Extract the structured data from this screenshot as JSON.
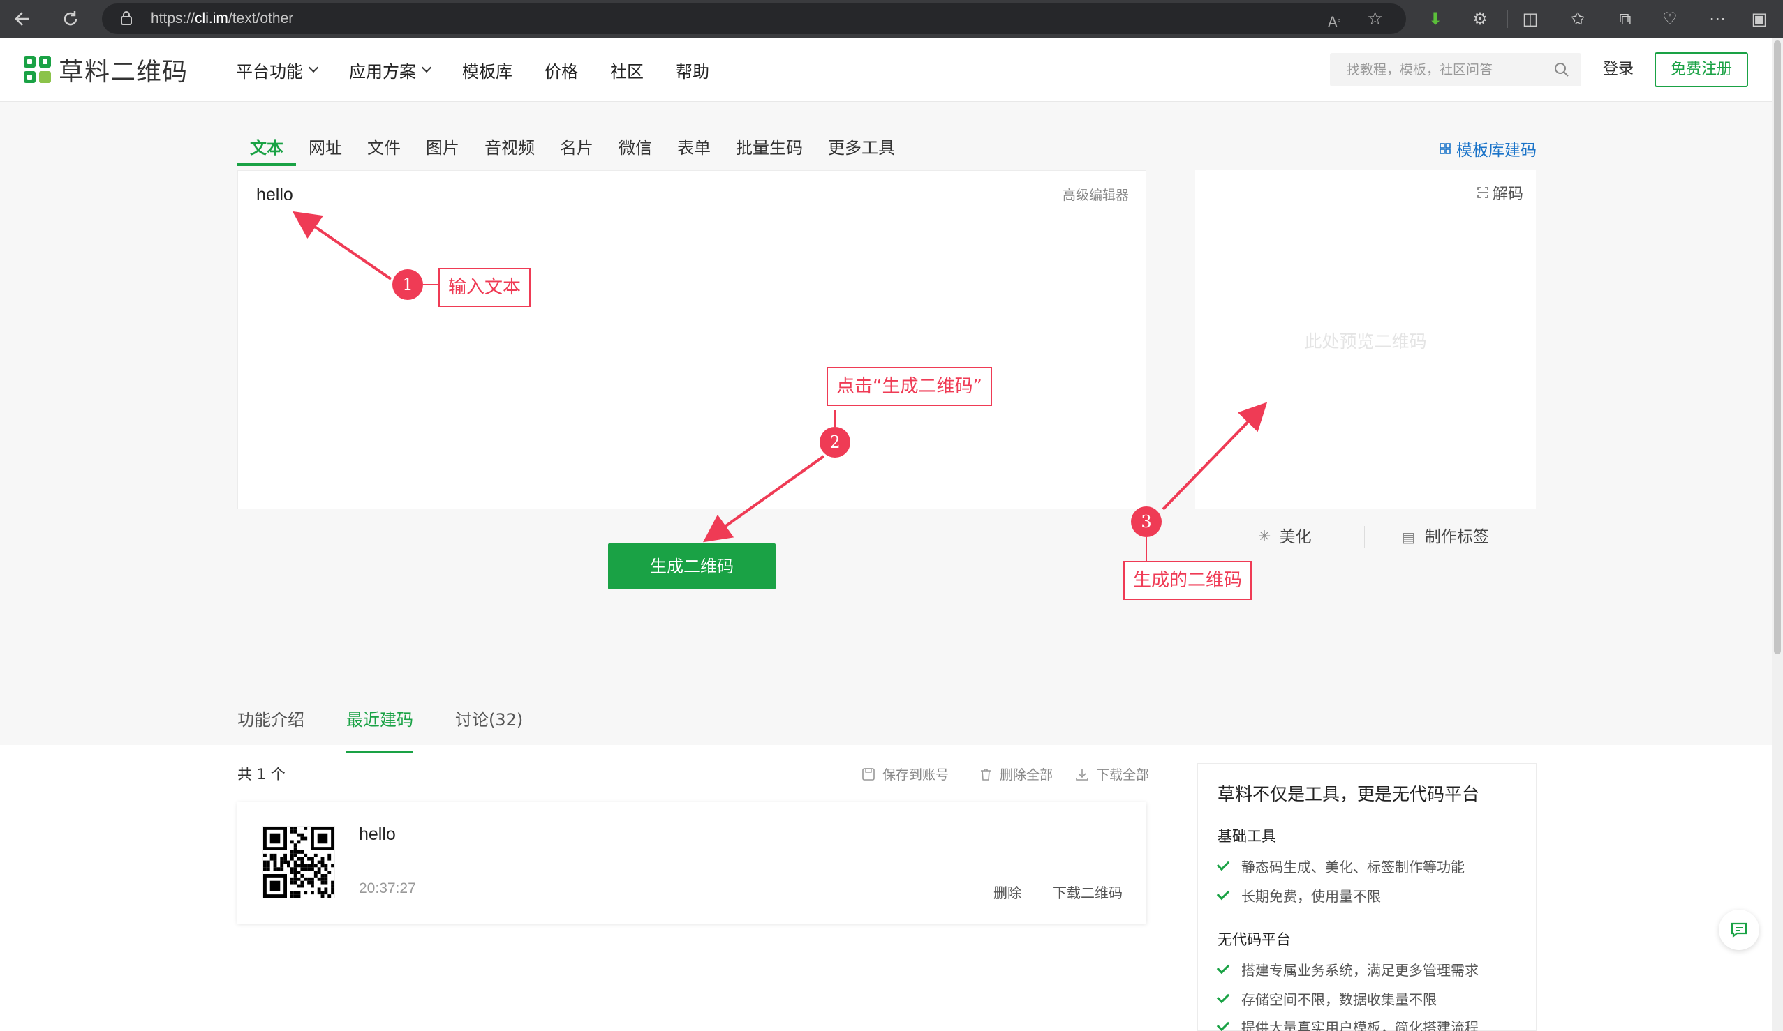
{
  "browser": {
    "url_prefix": "https://",
    "url_domain": "cli.im",
    "url_path": "/text/other"
  },
  "header": {
    "logo_text": "草料二维码",
    "nav": [
      {
        "label": "平台功能",
        "has_dropdown": true
      },
      {
        "label": "应用方案",
        "has_dropdown": true
      },
      {
        "label": "模板库",
        "has_dropdown": false
      },
      {
        "label": "价格",
        "has_dropdown": false
      },
      {
        "label": "社区",
        "has_dropdown": false
      },
      {
        "label": "帮助",
        "has_dropdown": false
      }
    ],
    "search_placeholder": "找教程，模板，社区问答",
    "login": "登录",
    "register": "免费注册"
  },
  "type_tabs": [
    {
      "label": "文本",
      "active": true
    },
    {
      "label": "网址",
      "active": false
    },
    {
      "label": "文件",
      "active": false
    },
    {
      "label": "图片",
      "active": false
    },
    {
      "label": "音视频",
      "active": false
    },
    {
      "label": "名片",
      "active": false
    },
    {
      "label": "微信",
      "active": false
    },
    {
      "label": "表单",
      "active": false
    },
    {
      "label": "批量生码",
      "active": false
    },
    {
      "label": "更多工具",
      "active": false
    }
  ],
  "template_link": "模板库建码",
  "editor": {
    "text": "hello",
    "advanced_editor": "高级编辑器"
  },
  "generate_button": "生成二维码",
  "preview": {
    "decode": "解码",
    "placeholder": "此处预览二维码",
    "beautify": "美化",
    "make_label": "制作标签"
  },
  "annotations": {
    "step1_number": "1",
    "step1_label": "输入文本",
    "step2_number": "2",
    "step2_label": "点击“生成二维码”",
    "step3_number": "3",
    "step3_label": "生成的二维码",
    "color": "#ef3b55"
  },
  "sub_tabs": [
    {
      "label": "功能介绍",
      "active": false
    },
    {
      "label": "最近建码",
      "active": true
    },
    {
      "label": "讨论(32)",
      "active": false
    }
  ],
  "recent": {
    "count": "共 1 个",
    "save_to_account": "保存到账号",
    "delete_all": "删除全部",
    "download_all": "下载全部",
    "records": [
      {
        "title": "hello",
        "time": "20:37:27",
        "delete": "删除",
        "download": "下载二维码"
      }
    ]
  },
  "info_card": {
    "title": "草料不仅是工具，更是无代码平台",
    "sections": [
      {
        "title": "基础工具",
        "items": [
          "静态码生成、美化、标签制作等功能",
          "长期免费，使用量不限"
        ]
      },
      {
        "title": "无代码平台",
        "items": [
          "搭建专属业务系统，满足更多管理需求",
          "存储空间不限，数据收集量不限",
          "提供大量真实用户模板，简化搭建流程"
        ]
      }
    ]
  },
  "colors": {
    "brand_green": "#1aa245",
    "link_blue": "#1a73c8",
    "annotation_red": "#ef3b55"
  }
}
